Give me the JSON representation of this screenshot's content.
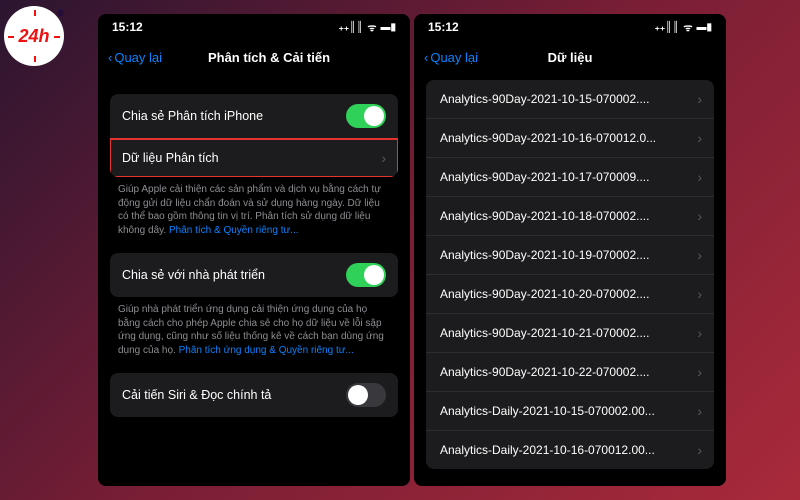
{
  "logo": {
    "text": "24h",
    "reg": "®"
  },
  "status": {
    "time": "15:12",
    "signal": "▪▪▪▪",
    "wifi": "ᯤ",
    "battery": "▮"
  },
  "left": {
    "back": "Quay lại",
    "title": "Phân tích & Cải tiến",
    "share_iphone": "Chia sẻ Phân tích iPhone",
    "analytics_data": "Dữ liệu Phân tích",
    "footer1_a": "Giúp Apple cải thiện các sản phẩm và dịch vụ bằng cách tự động gửi dữ liệu chẩn đoán và sử dụng hàng ngày. Dữ liệu có thể bao gồm thông tin vị trí. Phân tích sử dụng dữ liệu không dây. ",
    "footer1_link": "Phân tích & Quyền riêng tư...",
    "share_dev": "Chia sẻ với nhà phát triển",
    "footer2_a": "Giúp nhà phát triển ứng dụng cải thiện ứng dụng của họ bằng cách cho phép Apple chia sẻ cho họ dữ liệu về lỗi sập ứng dụng, cũng như số liệu thống kê về cách bạn dùng ứng dụng của họ. ",
    "footer2_link": "Phân tích ứng dụng & Quyền riêng tư...",
    "siri": "Cải tiến Siri & Đọc chính tả"
  },
  "right": {
    "back": "Quay lại",
    "title": "Dữ liệu",
    "files": [
      "Analytics-90Day-2021-10-15-070002....",
      "Analytics-90Day-2021-10-16-070012.0...",
      "Analytics-90Day-2021-10-17-070009....",
      "Analytics-90Day-2021-10-18-070002....",
      "Analytics-90Day-2021-10-19-070002....",
      "Analytics-90Day-2021-10-20-070002....",
      "Analytics-90Day-2021-10-21-070002....",
      "Analytics-90Day-2021-10-22-070002....",
      "Analytics-Daily-2021-10-15-070002.00...",
      "Analytics-Daily-2021-10-16-070012.00..."
    ]
  }
}
